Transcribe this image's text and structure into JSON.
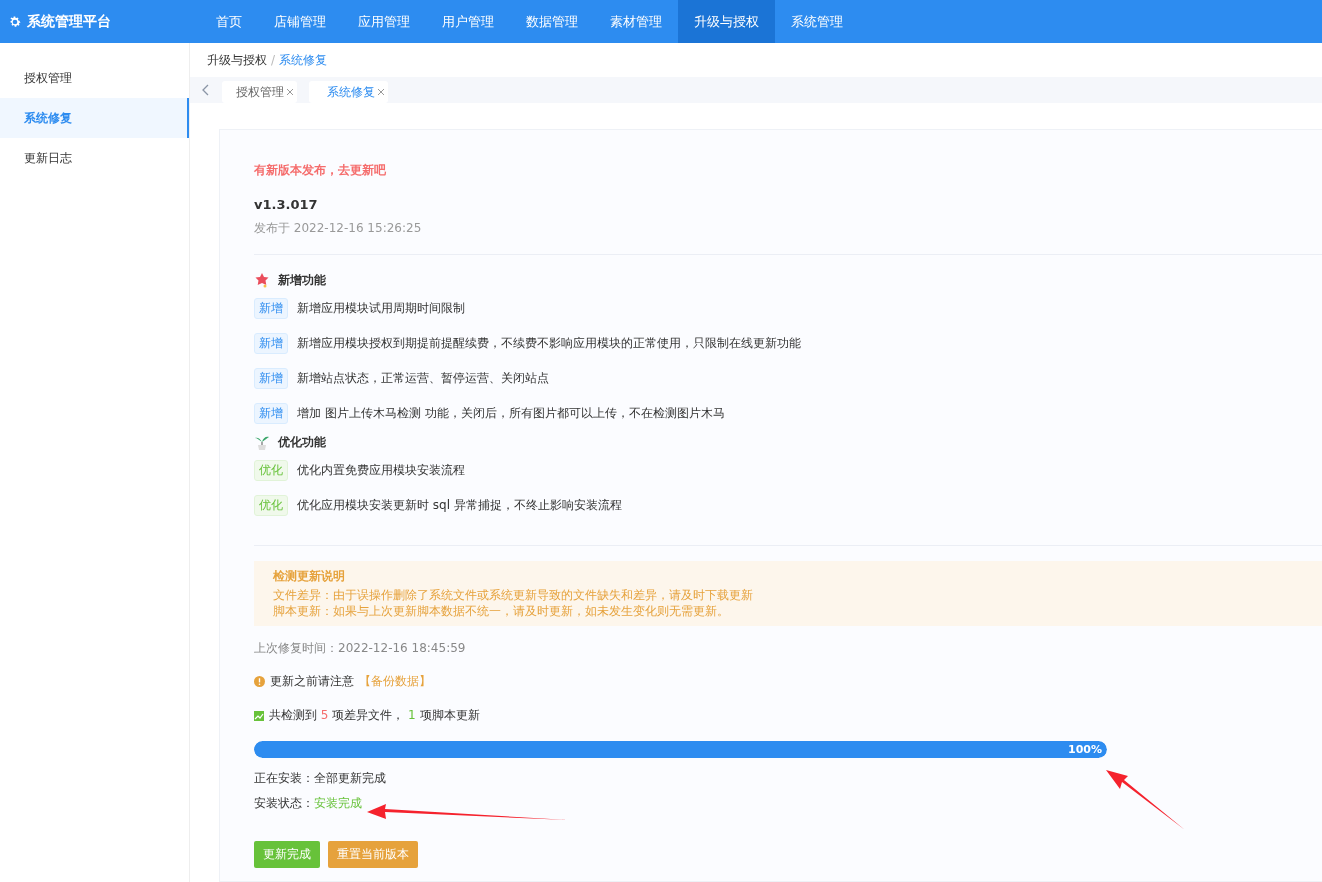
{
  "header": {
    "title": "系统管理平台",
    "nav": [
      {
        "label": "首页",
        "selected": false
      },
      {
        "label": "店铺管理",
        "selected": false
      },
      {
        "label": "应用管理",
        "selected": false
      },
      {
        "label": "用户管理",
        "selected": false
      },
      {
        "label": "数据管理",
        "selected": false
      },
      {
        "label": "素材管理",
        "selected": false
      },
      {
        "label": "升级与授权",
        "selected": true
      },
      {
        "label": "系统管理",
        "selected": false
      }
    ]
  },
  "sidebar": {
    "items": [
      {
        "label": "授权管理",
        "selected": false
      },
      {
        "label": "系统修复",
        "selected": true
      },
      {
        "label": "更新日志",
        "selected": false
      }
    ]
  },
  "breadcrumb": {
    "separator": "/",
    "items": [
      "升级与授权",
      "系统修复"
    ]
  },
  "tabs": [
    {
      "label": "授权管理",
      "selected": false
    },
    {
      "label": "系统修复",
      "selected": true
    }
  ],
  "release": {
    "notice": "有新版本发布，去更新吧",
    "version": "v1.3.017",
    "date": "发布于 2022-12-16 15:26:25"
  },
  "sections": [
    {
      "kind": "new",
      "title": "新增功能",
      "items": [
        {
          "tag": "新增",
          "text": "新增应用模块试用周期时间限制"
        },
        {
          "tag": "新增",
          "text": "新增应用模块授权到期提前提醒续费，不续费不影响应用模块的正常使用，只限制在线更新功能"
        },
        {
          "tag": "新增",
          "text": "新增站点状态，正常运营、暂停运营、关闭站点"
        },
        {
          "tag": "新增",
          "text": "增加 图片上传木马检测 功能，关闭后，所有图片都可以上传，不在检测图片木马"
        }
      ]
    },
    {
      "kind": "optimize",
      "title": "优化功能",
      "items": [
        {
          "tag": "优化",
          "text": "优化内置免费应用模块安装流程"
        },
        {
          "tag": "优化",
          "text": "优化应用模块安装更新时 sql 异常捕捉，不终止影响安装流程"
        }
      ]
    }
  ],
  "info_box": {
    "title": "检测更新说明",
    "lines": [
      "文件差异：由于误操作删除了系统文件或系统更新导致的文件缺失和差异，请及时下载更新",
      "脚本更新：如果与上次更新脚本数据不统一，请及时更新，如未发生变化则无需更新。"
    ]
  },
  "last_repair": "上次修复时间：2022-12-16 18:45:59",
  "warning": {
    "text": "更新之前请注意",
    "link": "【备份数据】"
  },
  "detect": {
    "prefix": "共检测到",
    "file_count": "5",
    "file_label": "项差异文件，",
    "script_count": "1",
    "script_label": "项脚本更新"
  },
  "progress": {
    "level": 1,
    "label": "100%"
  },
  "installing": {
    "label": "正在安装：",
    "value": "全部更新完成"
  },
  "status": {
    "label": "安装状态：",
    "value": "安装完成"
  },
  "buttons": [
    {
      "kind": "success",
      "label": "更新完成"
    },
    {
      "kind": "warning",
      "label": "重置当前版本"
    }
  ]
}
